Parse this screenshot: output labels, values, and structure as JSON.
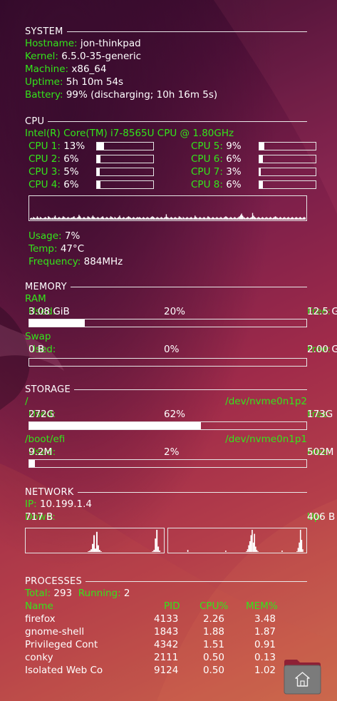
{
  "system": {
    "header": "SYSTEM",
    "rows": [
      {
        "label": "Hostname:",
        "value": "jon-thinkpad"
      },
      {
        "label": "Kernel:",
        "value": "6.5.0-35-generic"
      },
      {
        "label": "Machine:",
        "value": "x86_64"
      },
      {
        "label": "Uptime:",
        "value": "5h 10m 54s"
      },
      {
        "label": "Battery:",
        "value": "99% (discharging; 10h 16m 5s)"
      }
    ]
  },
  "cpu": {
    "header": "CPU",
    "model": "Intel(R) Core(TM) i7-8565U CPU @ 1.80GHz",
    "cores": [
      {
        "label": "CPU 1:",
        "value": "13%",
        "level": 0.13
      },
      {
        "label": "CPU 2:",
        "value": "6%",
        "level": 0.06
      },
      {
        "label": "CPU 3:",
        "value": "5%",
        "level": 0.05
      },
      {
        "label": "CPU 4:",
        "value": "6%",
        "level": 0.06
      },
      {
        "label": "CPU 5:",
        "value": "9%",
        "level": 0.09
      },
      {
        "label": "CPU 6:",
        "value": "6%",
        "level": 0.06
      },
      {
        "label": "CPU 7:",
        "value": "3%",
        "level": 0.03
      },
      {
        "label": "CPU 8:",
        "value": "6%",
        "level": 0.06
      }
    ],
    "history": [
      2,
      3,
      2,
      4,
      3,
      2,
      3,
      5,
      3,
      2,
      4,
      3,
      2,
      2,
      3,
      4,
      3,
      2,
      5,
      4,
      3,
      2,
      3,
      2,
      4,
      6,
      3,
      2,
      3,
      4,
      3,
      2,
      3,
      5,
      4,
      3,
      2,
      3,
      4,
      3,
      2,
      3,
      3,
      4,
      5,
      3,
      2,
      3,
      4,
      7,
      5,
      3,
      2,
      3,
      4,
      3,
      2,
      3,
      5,
      4,
      3,
      2,
      4,
      6,
      4,
      3,
      2,
      3,
      4,
      3,
      2,
      3,
      4,
      5,
      3,
      2,
      3,
      4,
      3,
      2,
      3,
      5,
      4,
      3,
      2,
      4,
      3,
      2,
      3,
      4,
      6,
      3,
      2,
      3,
      4,
      3,
      2,
      3,
      4,
      5,
      4,
      3,
      2,
      3,
      4,
      3,
      2,
      3,
      4,
      3,
      4,
      3,
      2,
      3,
      4,
      3,
      2,
      3,
      4,
      3,
      2,
      3,
      4,
      5,
      4,
      3,
      2,
      3,
      4,
      3,
      2,
      3,
      4,
      3,
      2,
      3,
      4,
      8,
      4,
      3,
      2,
      3,
      4,
      3,
      2,
      3,
      4,
      3,
      2,
      3,
      5,
      4,
      3,
      2,
      4,
      3,
      2,
      3,
      4,
      3,
      2,
      3,
      4,
      3,
      2,
      3,
      6,
      4,
      3,
      2,
      3,
      4,
      3,
      2,
      3,
      4,
      3,
      2,
      3,
      5,
      4,
      3,
      2,
      3,
      4,
      3,
      2,
      3,
      4,
      3,
      2,
      3,
      4,
      3,
      2,
      3,
      4,
      5,
      4,
      3,
      2,
      3,
      4,
      3,
      2,
      3,
      4,
      3,
      2,
      3,
      4,
      5,
      7,
      9,
      6,
      4,
      3,
      2,
      3,
      4,
      3,
      2,
      3,
      4,
      10,
      6,
      4,
      3,
      2,
      3,
      4,
      3,
      2,
      3,
      4,
      3,
      2,
      3,
      4,
      3,
      2,
      3,
      4,
      3,
      2,
      3,
      4,
      5,
      4,
      3,
      2,
      3,
      4,
      3,
      2,
      3,
      4,
      3,
      2,
      3,
      4,
      3,
      2,
      3,
      4,
      3,
      2,
      3,
      4,
      3,
      2,
      3,
      4,
      3,
      2,
      3,
      4,
      3
    ],
    "usage_label": "Usage:",
    "usage_value": "7%",
    "temp_label": "Temp:",
    "temp_value": "47°C",
    "freq_label": "Frequency:",
    "freq_value": "884MHz"
  },
  "memory": {
    "header": "MEMORY",
    "ram": {
      "title": "RAM",
      "used_label": "Used:",
      "used": "3.08 GiB",
      "pct": "20%",
      "free_label": "Free:",
      "free": "12.5 GiB",
      "level": 0.2
    },
    "swap": {
      "title": "Swap",
      "used_label": "Used:",
      "used": "0 B",
      "pct": "0%",
      "free_label": "Free:",
      "free": "2.00 GiB",
      "level": 0.0
    }
  },
  "storage": {
    "header": "STORAGE",
    "disks": [
      {
        "mount": "/",
        "device": "/dev/nvme0n1p2",
        "used_label": "Used:",
        "used": "272G",
        "pct": "62%",
        "free_label": "Free:",
        "free": "173G",
        "level": 0.62
      },
      {
        "mount": "/boot/efi",
        "device": "/dev/nvme0n1p1",
        "used_label": "Used:",
        "used": "9.2M",
        "pct": "2%",
        "free_label": "Free:",
        "free": "502M",
        "level": 0.02
      }
    ]
  },
  "network": {
    "header": "NETWORK",
    "ip_label": "IP:",
    "ip": "10.199.1.4",
    "down_label": "Down:",
    "down": "717 B",
    "up_label": "Up:",
    "up": "406 B",
    "down_history": [
      0,
      0,
      0,
      0,
      0,
      0,
      0,
      0,
      0,
      0,
      0,
      0,
      0,
      0,
      0,
      0,
      0,
      0,
      0,
      0,
      0,
      0,
      0,
      0,
      0,
      0,
      0,
      0,
      0,
      0,
      0,
      0,
      0,
      0,
      0,
      0,
      0,
      0,
      0,
      0,
      0,
      0,
      0,
      0,
      1,
      2,
      4,
      12,
      25,
      5,
      30,
      10,
      3,
      1,
      0,
      0,
      0,
      0,
      0,
      0,
      0,
      0,
      0,
      0,
      0,
      0,
      0,
      0,
      0,
      0,
      0,
      0,
      0,
      0,
      0,
      0,
      0,
      0,
      0,
      0,
      0,
      0,
      0,
      0,
      0,
      0,
      0,
      0,
      0,
      0,
      1,
      3,
      20,
      33,
      8,
      2,
      0,
      0
    ],
    "up_history": [
      0,
      0,
      0,
      0,
      0,
      0,
      0,
      0,
      0,
      0,
      0,
      0,
      0,
      0,
      0,
      0,
      3,
      0,
      0,
      0,
      0,
      0,
      0,
      0,
      0,
      0,
      0,
      0,
      0,
      0,
      0,
      0,
      0,
      0,
      0,
      0,
      0,
      0,
      0,
      0,
      0,
      0,
      0,
      0,
      0,
      0,
      0,
      0,
      0,
      2,
      0,
      0,
      0,
      0,
      0,
      0,
      0,
      0,
      0,
      0,
      0,
      0,
      0,
      0,
      0,
      0,
      0,
      1,
      4,
      10,
      16,
      25,
      33,
      14,
      27,
      8,
      3,
      1,
      0,
      0,
      0,
      0,
      0,
      0,
      0,
      0,
      0,
      0,
      0,
      0,
      0,
      0,
      0,
      0,
      0,
      0,
      0,
      0,
      2,
      0,
      0,
      0,
      0,
      0,
      0,
      0,
      0,
      0,
      0,
      0,
      0,
      1,
      6,
      14,
      33,
      18,
      4,
      0,
      0
    ]
  },
  "processes": {
    "header": "PROCESSES",
    "total_label": "Total:",
    "total": "293",
    "running_label": "Running:",
    "running": "2",
    "columns": {
      "name": "Name",
      "pid": "PID",
      "cpu": "CPU%",
      "mem": "MEM%"
    },
    "rows": [
      {
        "name": "firefox",
        "pid": "4133",
        "cpu": "2.26",
        "mem": "3.48"
      },
      {
        "name": "gnome-shell",
        "pid": "1843",
        "cpu": "1.88",
        "mem": "1.87"
      },
      {
        "name": "Privileged Cont",
        "pid": "4342",
        "cpu": "1.51",
        "mem": "0.91"
      },
      {
        "name": "conky",
        "pid": "2111",
        "cpu": "0.50",
        "mem": "0.13"
      },
      {
        "name": "Isolated Web Co",
        "pid": "9124",
        "cpu": "0.50",
        "mem": "1.02"
      }
    ]
  },
  "colors": {
    "label": "#33e61a",
    "value": "#ffffff",
    "rule": "#e9e9e9"
  },
  "dock": {
    "icon": "home-folder-icon"
  }
}
